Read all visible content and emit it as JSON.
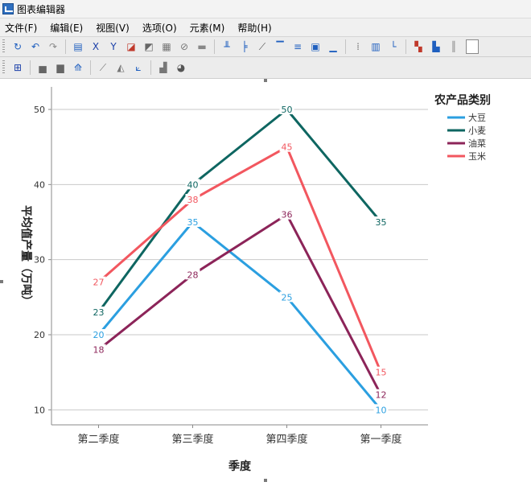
{
  "window": {
    "title": "图表编辑器"
  },
  "menu": [
    "文件(F)",
    "编辑(E)",
    "视图(V)",
    "选项(O)",
    "元素(M)",
    "帮助(H)"
  ],
  "toolbar1": [
    {
      "icon": "rotate-icon",
      "glyph": "↻",
      "color": "#1f5fbf"
    },
    {
      "icon": "undo-icon",
      "glyph": "↶",
      "color": "#1f5fbf"
    },
    {
      "icon": "redo-icon",
      "glyph": "↷",
      "color": "#8a8a8a"
    },
    {
      "icon": "properties-icon",
      "glyph": "▤",
      "color": "#1f5fbf"
    },
    {
      "icon": "x-axis-icon",
      "glyph": "X",
      "color": "#1a3fa8"
    },
    {
      "icon": "y-axis-icon",
      "glyph": "Y",
      "color": "#1a3fa8"
    },
    {
      "icon": "scale-icon",
      "glyph": "◪",
      "color": "#c0392b"
    },
    {
      "icon": "transform-icon",
      "glyph": "◩",
      "color": "#666666"
    },
    {
      "icon": "data-icon",
      "glyph": "▦",
      "color": "#777777"
    },
    {
      "icon": "lasso-icon",
      "glyph": "⊘",
      "color": "#777777"
    },
    {
      "icon": "frame-icon",
      "glyph": "▬",
      "color": "#888888"
    },
    {
      "icon": "refline-x-icon",
      "glyph": "╨",
      "color": "#1f5fbf"
    },
    {
      "icon": "refline-y-icon",
      "glyph": "╞",
      "color": "#1f5fbf"
    },
    {
      "icon": "fit-line-icon",
      "glyph": "⟋",
      "color": "#555555"
    },
    {
      "icon": "title-icon",
      "glyph": "▔",
      "color": "#1f5fbf"
    },
    {
      "icon": "annotation-icon",
      "glyph": "≡",
      "color": "#1f5fbf"
    },
    {
      "icon": "textbox-icon",
      "glyph": "▣",
      "color": "#1f5fbf"
    },
    {
      "icon": "footnote-icon",
      "glyph": "▁",
      "color": "#1f5fbf"
    },
    {
      "icon": "gridlines-icon",
      "glyph": "⁞",
      "color": "#777777"
    },
    {
      "icon": "table-icon",
      "glyph": "▥",
      "color": "#1f5fbf"
    },
    {
      "icon": "axis-icon",
      "glyph": "└",
      "color": "#1f5fbf"
    },
    {
      "icon": "legend-icon",
      "glyph": "▚",
      "color": "#c0392b"
    },
    {
      "icon": "sort-icon",
      "glyph": "▙",
      "color": "#1f5fbf"
    },
    {
      "icon": "columns-icon",
      "glyph": "║",
      "color": "#888888"
    }
  ],
  "toolbar2": [
    {
      "icon": "select-all-icon",
      "glyph": "⊞",
      "color": "#1a3fa8"
    },
    {
      "icon": "bar-chart-icon",
      "glyph": "▅",
      "color": "#666666"
    },
    {
      "icon": "clustered-bar-icon",
      "glyph": "▆",
      "color": "#666666"
    },
    {
      "icon": "line-chart-icon",
      "glyph": "⟰",
      "color": "#1f5fbf"
    },
    {
      "icon": "dropline-icon",
      "glyph": "⟋",
      "color": "#777777"
    },
    {
      "icon": "area-chart-icon",
      "glyph": "◭",
      "color": "#777777"
    },
    {
      "icon": "path-icon",
      "glyph": "⟀",
      "color": "#1f5fbf"
    },
    {
      "icon": "histogram-icon",
      "glyph": "▟",
      "color": "#777777"
    },
    {
      "icon": "pie-chart-icon",
      "glyph": "◕",
      "color": "#555555"
    }
  ],
  "chart_data": {
    "type": "line",
    "categories": [
      "第二季度",
      "第三季度",
      "第四季度",
      "第一季度"
    ],
    "xlabel": "季度",
    "ylabel": "平均值产量（万吨）",
    "ylim": [
      8,
      53
    ],
    "yticks": [
      10,
      20,
      30,
      40,
      50
    ],
    "grid": true,
    "legend": {
      "title": "农产品类别",
      "position": "top-right"
    },
    "series": [
      {
        "name": "大豆",
        "values": [
          20,
          35,
          25,
          10
        ],
        "color": "#2b9fe0",
        "labels": [
          "20",
          "35",
          "25",
          "10"
        ]
      },
      {
        "name": "小麦",
        "values": [
          23,
          40,
          50,
          35
        ],
        "color": "#0e6661",
        "labels": [
          "23",
          "40",
          "50",
          "35"
        ]
      },
      {
        "name": "油菜",
        "values": [
          18,
          28,
          36,
          12
        ],
        "color": "#8c2459",
        "labels": [
          "18",
          "28",
          "36",
          "12"
        ]
      },
      {
        "name": "玉米",
        "values": [
          27,
          38,
          45,
          15
        ],
        "color": "#f2575f",
        "labels": [
          "27",
          "38",
          "45",
          "15"
        ]
      }
    ]
  }
}
